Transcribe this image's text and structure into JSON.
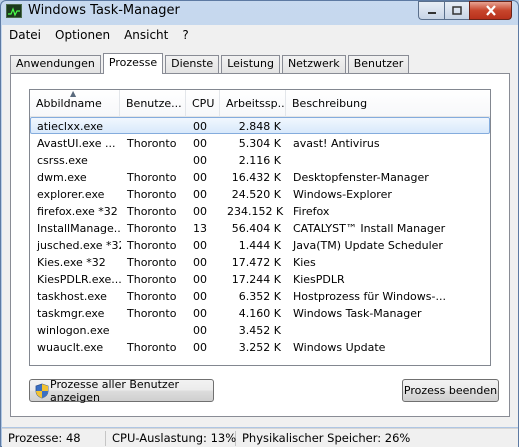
{
  "window": {
    "title": "Windows Task-Manager"
  },
  "menu": [
    "Datei",
    "Optionen",
    "Ansicht",
    "?"
  ],
  "tabs": [
    {
      "label": "Anwendungen",
      "active": false
    },
    {
      "label": "Prozesse",
      "active": true
    },
    {
      "label": "Dienste",
      "active": false
    },
    {
      "label": "Leistung",
      "active": false
    },
    {
      "label": "Netzwerk",
      "active": false
    },
    {
      "label": "Benutzer",
      "active": false
    }
  ],
  "columns": {
    "name": "Abbildname",
    "user": "Benutze...",
    "cpu": "CPU",
    "mem": "Arbeitssp...",
    "desc": "Beschreibung"
  },
  "processes": [
    {
      "name": "atieclxx.exe",
      "user": "",
      "cpu": "00",
      "mem": "2.848 K",
      "desc": "",
      "selected": true
    },
    {
      "name": "AvastUI.exe ...",
      "user": "Thoronto",
      "cpu": "00",
      "mem": "5.304 K",
      "desc": "avast! Antivirus"
    },
    {
      "name": "csrss.exe",
      "user": "",
      "cpu": "00",
      "mem": "2.116 K",
      "desc": ""
    },
    {
      "name": "dwm.exe",
      "user": "Thoronto",
      "cpu": "00",
      "mem": "16.432 K",
      "desc": "Desktopfenster-Manager"
    },
    {
      "name": "explorer.exe",
      "user": "Thoronto",
      "cpu": "00",
      "mem": "24.520 K",
      "desc": "Windows-Explorer"
    },
    {
      "name": "firefox.exe *32",
      "user": "Thoronto",
      "cpu": "00",
      "mem": "234.152 K",
      "desc": "Firefox"
    },
    {
      "name": "InstallManage...",
      "user": "Thoronto",
      "cpu": "13",
      "mem": "56.404 K",
      "desc": "CATALYST™ Install Manager"
    },
    {
      "name": "jusched.exe *32",
      "user": "Thoronto",
      "cpu": "00",
      "mem": "1.444 K",
      "desc": "Java(TM) Update Scheduler"
    },
    {
      "name": "Kies.exe *32",
      "user": "Thoronto",
      "cpu": "00",
      "mem": "17.472 K",
      "desc": "Kies"
    },
    {
      "name": "KiesPDLR.exe...",
      "user": "Thoronto",
      "cpu": "00",
      "mem": "17.244 K",
      "desc": "KiesPDLR"
    },
    {
      "name": "taskhost.exe",
      "user": "Thoronto",
      "cpu": "00",
      "mem": "6.352 K",
      "desc": "Hostprozess für Windows-..."
    },
    {
      "name": "taskmgr.exe",
      "user": "Thoronto",
      "cpu": "00",
      "mem": "4.160 K",
      "desc": "Windows Task-Manager"
    },
    {
      "name": "winlogon.exe",
      "user": "",
      "cpu": "00",
      "mem": "3.452 K",
      "desc": ""
    },
    {
      "name": "wuauclt.exe",
      "user": "Thoronto",
      "cpu": "00",
      "mem": "3.252 K",
      "desc": "Windows Update"
    }
  ],
  "buttons": {
    "show_all": "Prozesse aller Benutzer anzeigen",
    "end_process": "Prozess beenden"
  },
  "status": {
    "processes": "Prozesse: 48",
    "cpu": "CPU-Auslastung: 13%",
    "memory": "Physikalischer Speicher: 26%"
  },
  "icons": {
    "app": "task-manager-icon",
    "shield": "uac-shield-icon",
    "sort": "sort-ascending-icon"
  },
  "colors": {
    "selection_border": "#84acdd",
    "close_button": "#c7452c"
  }
}
